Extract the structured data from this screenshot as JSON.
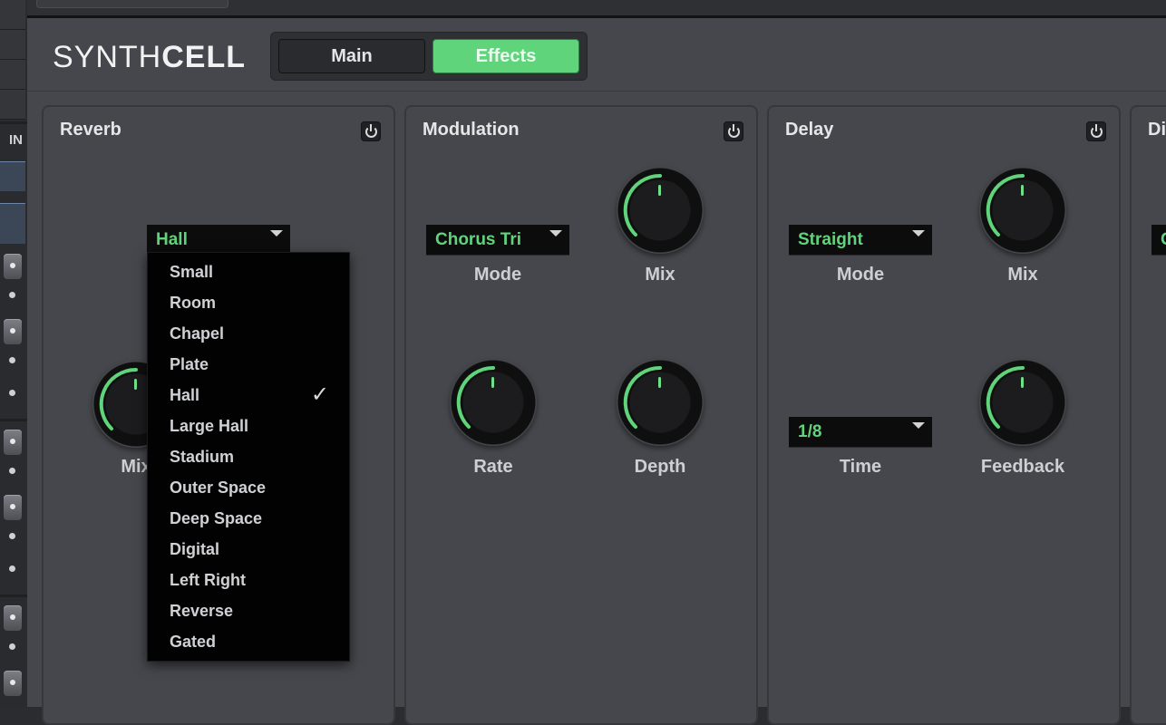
{
  "host": {
    "strip_label": "IN"
  },
  "header": {
    "logo_thin": "SYNTH",
    "logo_bold": "CELL",
    "tabs": [
      {
        "label": "Main",
        "active": false
      },
      {
        "label": "Effects",
        "active": true
      }
    ]
  },
  "panels": {
    "reverb": {
      "title": "Reverb",
      "type_value": "Hall",
      "mix_label": "Mix",
      "menu": {
        "items": [
          "Small",
          "Room",
          "Chapel",
          "Plate",
          "Hall",
          "Large Hall",
          "Stadium",
          "Outer Space",
          "Deep Space",
          "Digital",
          "Left Right",
          "Reverse",
          "Gated"
        ],
        "selected": "Hall",
        "check_glyph": "✓"
      }
    },
    "modulation": {
      "title": "Modulation",
      "mode_value": "Chorus Tri",
      "mode_label": "Mode",
      "mix_label": "Mix",
      "rate_label": "Rate",
      "depth_label": "Depth"
    },
    "delay": {
      "title": "Delay",
      "mode_value": "Straight",
      "mode_label": "Mode",
      "mix_label": "Mix",
      "time_value": "1/8",
      "time_label": "Time",
      "feedback_label": "Feedback"
    },
    "distortion": {
      "title": "Di",
      "mode_value": "C"
    }
  },
  "colors": {
    "accent": "#5fd47b",
    "panel_bg": "#45474c",
    "dropdown_bg": "#0c0c0d"
  }
}
